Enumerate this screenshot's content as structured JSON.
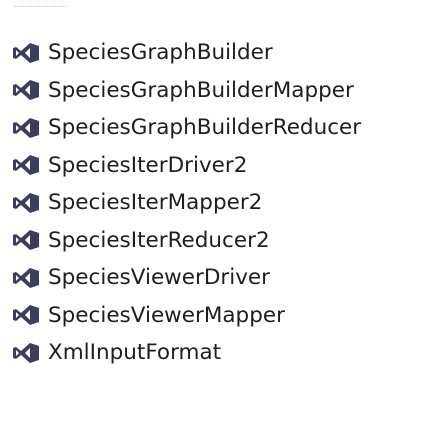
{
  "files": [
    {
      "name": "SpeciesGraphBuilder",
      "icon": "vs-file-icon"
    },
    {
      "name": "SpeciesGraphBuilderMapper",
      "icon": "vs-file-icon"
    },
    {
      "name": "SpeciesGraphBuilderReducer",
      "icon": "vs-file-icon"
    },
    {
      "name": "SpeciesIterDriver2",
      "icon": "vs-file-icon"
    },
    {
      "name": "SpeciesIterMapper2",
      "icon": "vs-file-icon"
    },
    {
      "name": "SpeciesIterReducer2",
      "icon": "vs-file-icon"
    },
    {
      "name": "SpeciesViewerDriver",
      "icon": "vs-file-icon"
    },
    {
      "name": "SpeciesViewerMapper",
      "icon": "vs-file-icon"
    },
    {
      "name": "XmlInputFormat",
      "icon": "vs-file-icon"
    }
  ],
  "colors": {
    "icon_dark": "#3d3d5c",
    "icon_accent": "#68217a",
    "text": "#1e1e1e"
  }
}
